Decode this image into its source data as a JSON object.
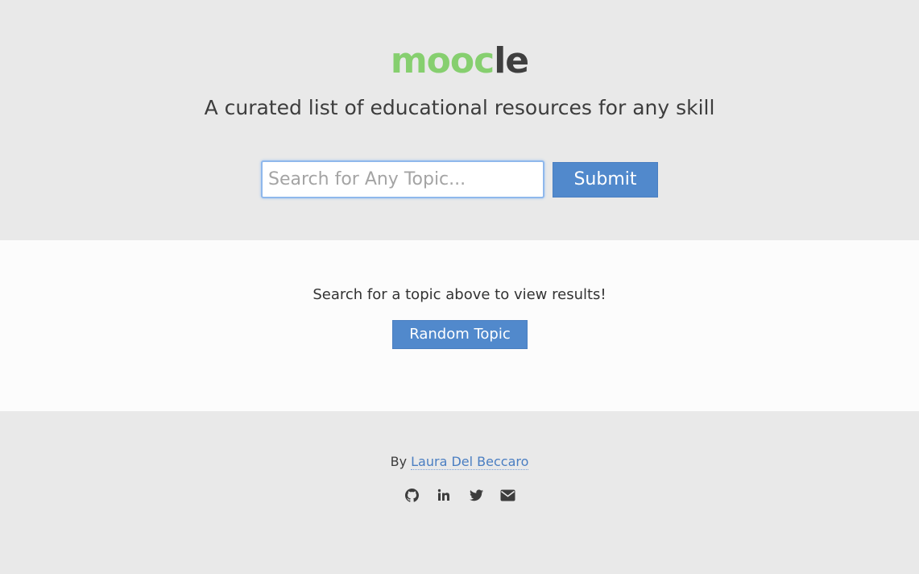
{
  "header": {
    "logo_green": "mooc",
    "logo_dark": "le",
    "tagline": "A curated list of educational resources for any skill",
    "search": {
      "placeholder": "Search for Any Topic...",
      "value": ""
    },
    "submit_label": "Submit"
  },
  "main": {
    "prompt": "Search for a topic above to view results!",
    "random_label": "Random Topic"
  },
  "footer": {
    "by_label": "By",
    "author_name": "Laura Del Beccaro",
    "social_icons": [
      "github-icon",
      "linkedin-icon",
      "twitter-icon",
      "email-icon"
    ]
  },
  "colors": {
    "header_bg": "#e9e9e9",
    "main_bg": "#fcfcfc",
    "logo_green": "#86cf6f",
    "logo_dark": "#3f3f3f",
    "button_blue": "#5189cc",
    "link_blue": "#4a7ec2"
  }
}
